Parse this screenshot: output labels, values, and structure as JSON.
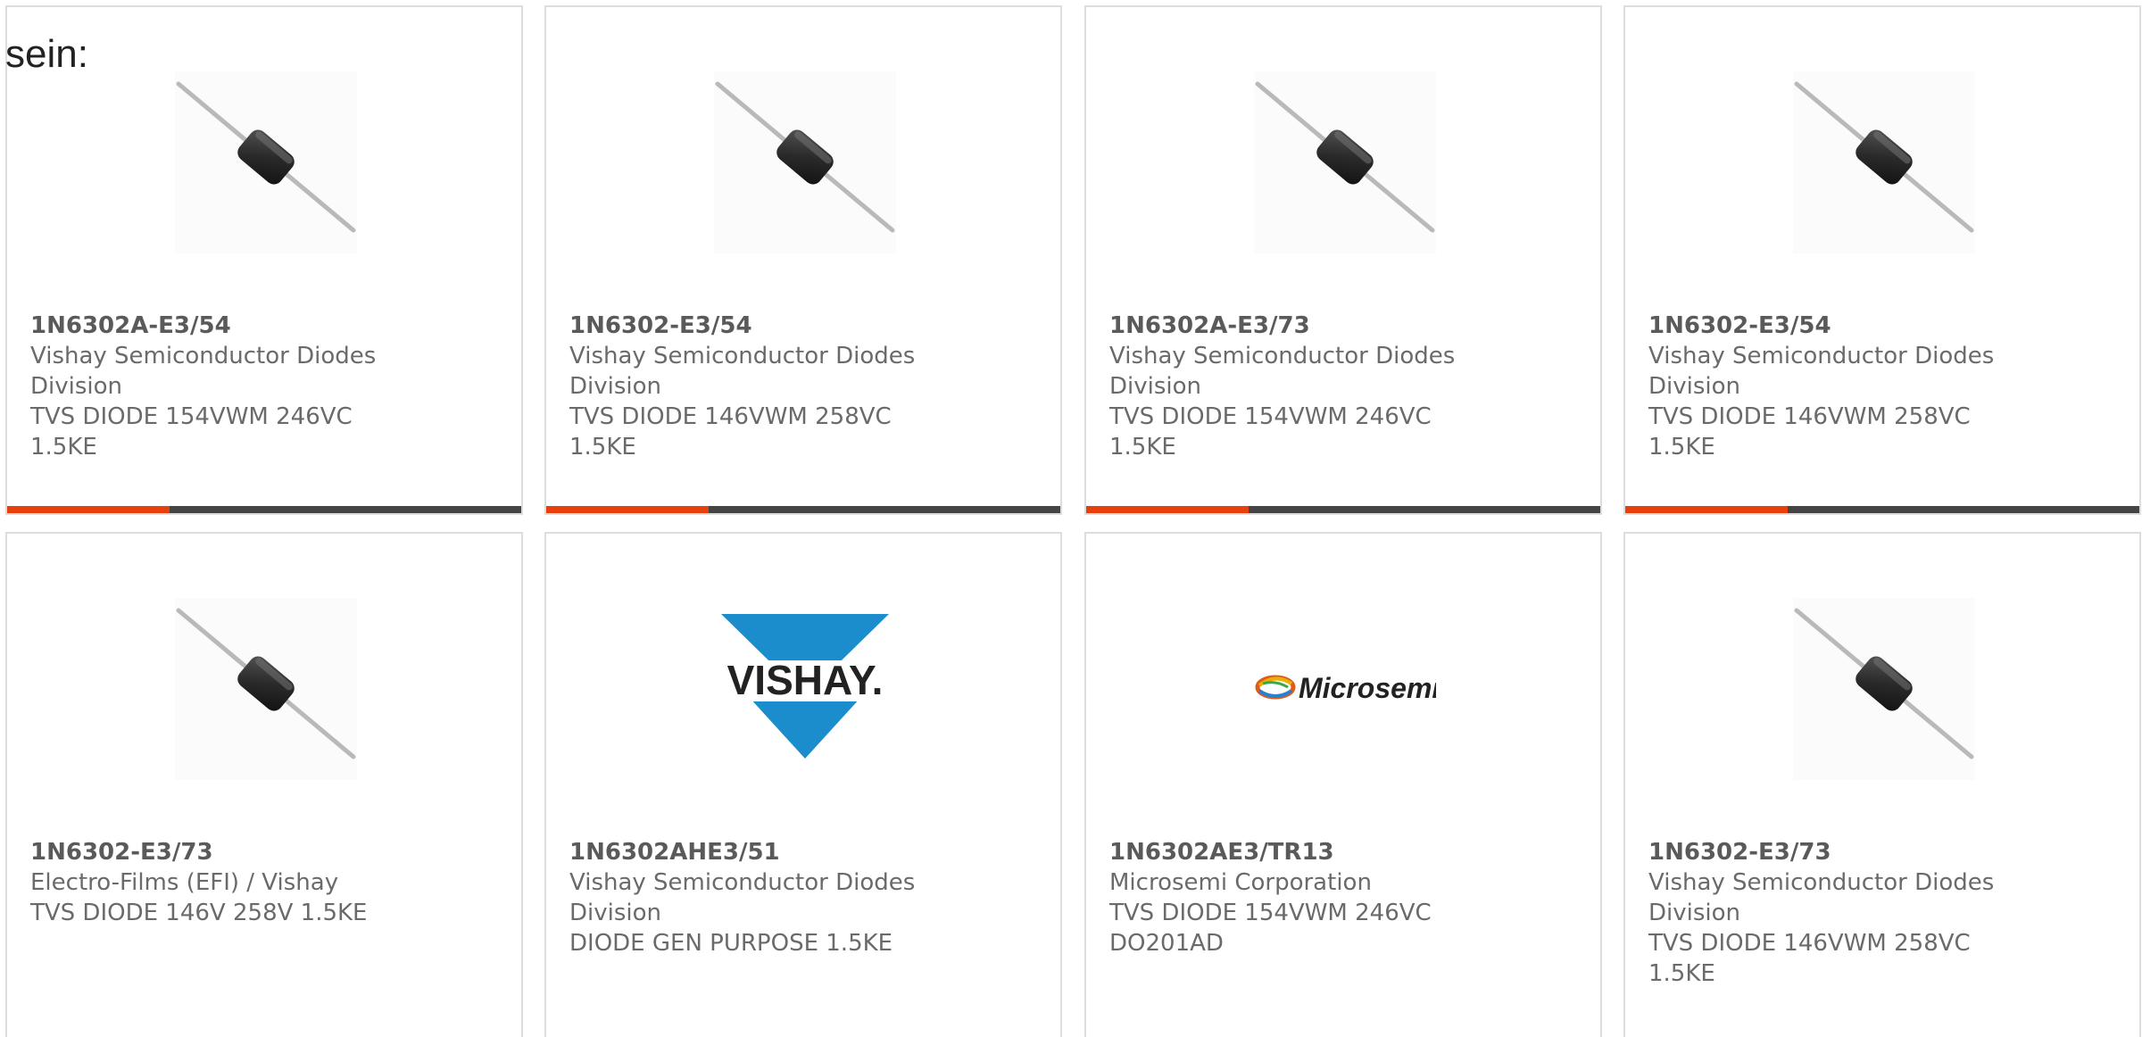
{
  "intro": {
    "text": "sein:"
  },
  "colors": {
    "accent": "#e8400c",
    "bar": "#444444",
    "border": "#dddddd",
    "text": "#666666",
    "vishay_blue": "#1b8ccc"
  },
  "products": [
    {
      "part_number": "1N6302A-E3/54",
      "manufacturer": "Vishay Semiconductor Diodes Division",
      "description": "TVS DIODE 154VWM 246VC 1.5KE",
      "image": "diode-icon"
    },
    {
      "part_number": "1N6302-E3/54",
      "manufacturer": "Vishay Semiconductor Diodes Division",
      "description": "TVS DIODE 146VWM 258VC 1.5KE",
      "image": "diode-icon"
    },
    {
      "part_number": "1N6302A-E3/73",
      "manufacturer": "Vishay Semiconductor Diodes Division",
      "description": "TVS DIODE 154VWM 246VC 1.5KE",
      "image": "diode-icon"
    },
    {
      "part_number": "1N6302-E3/54",
      "manufacturer": "Vishay Semiconductor Diodes Division",
      "description": "TVS DIODE 146VWM 258VC 1.5KE",
      "image": "diode-icon"
    },
    {
      "part_number": "1N6302-E3/73",
      "manufacturer": "Electro-Films (EFI) / Vishay",
      "description": "TVS DIODE 146V 258V 1.5KE",
      "image": "diode-icon"
    },
    {
      "part_number": "1N6302AHE3/51",
      "manufacturer": "Vishay Semiconductor Diodes Division",
      "description": "DIODE GEN PURPOSE 1.5KE",
      "image": "vishay-logo",
      "logo_text": "VISHAY."
    },
    {
      "part_number": "1N6302AE3/TR13",
      "manufacturer": "Microsemi Corporation",
      "description": "TVS DIODE 154VWM 246VC DO201AD",
      "image": "microsemi-logo",
      "logo_text": "Microsemi"
    },
    {
      "part_number": "1N6302-E3/73",
      "manufacturer": "Vishay Semiconductor Diodes Division",
      "description": "TVS DIODE 146VWM 258VC 1.5KE",
      "image": "diode-icon"
    }
  ]
}
